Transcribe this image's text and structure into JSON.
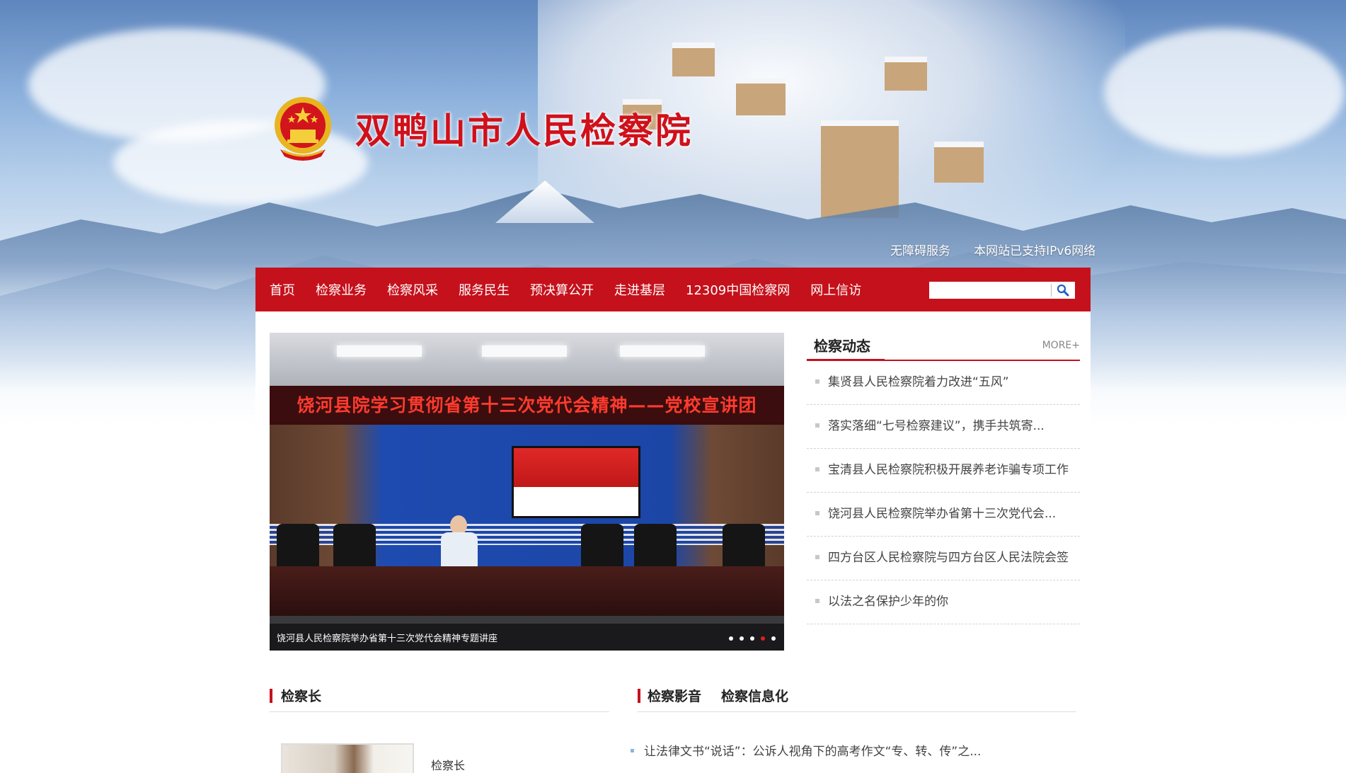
{
  "header": {
    "site_title": "双鸭山市人民检察院",
    "top_links": [
      "无障碍服务",
      "本网站已支持IPv6网络"
    ]
  },
  "nav": {
    "items": [
      "首页",
      "检察业务",
      "检察风采",
      "服务民生",
      "预决算公开",
      "走进基层",
      "12309中国检察网",
      "网上信访"
    ],
    "search_placeholder": ""
  },
  "slider": {
    "led_text": "饶河县院学习贯彻省第十三次党代会精神——党校宣讲团",
    "caption": "饶河县人民检察院举办省第十三次党代会精神专题讲座",
    "dot_count": 5,
    "active_dot": 4
  },
  "news": {
    "title": "检察动态",
    "more_label": "MORE+",
    "items": [
      "集贤县人民检察院着力改进“五风”",
      "落实落细“七号检察建议”，携手共筑寄...",
      "宝清县人民检察院积极开展养老诈骗专项工作",
      "饶河县人民检察院举办省第十三次党代会...",
      "四方台区人民检察院与四方台区人民法院会签",
      "以法之名保护少年的你"
    ]
  },
  "sections": {
    "chief": {
      "title": "检察长",
      "name": "检察长"
    },
    "media": {
      "tabs": [
        "检察影音",
        "检察信息化"
      ],
      "items": [
        "让法律文书“说话”：公诉人视角下的高考作文“专、转、传”之..."
      ]
    }
  },
  "colors": {
    "brand_red": "#c5111b",
    "title_red": "#d0101a"
  }
}
